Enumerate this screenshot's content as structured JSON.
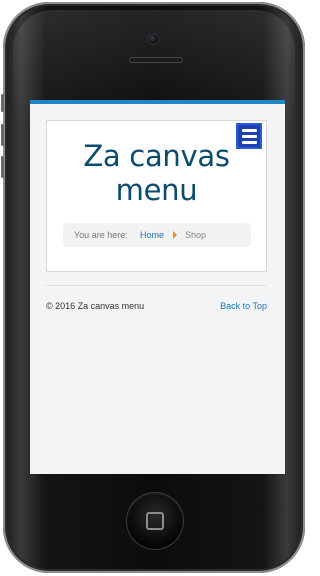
{
  "header": {
    "site_title": "Za canvas menu",
    "menu_icon": "hamburger-menu-icon"
  },
  "breadcrumb": {
    "prefix": "You are here:",
    "home_label": "Home",
    "separator_icon": "triangle-right-icon",
    "current": "Shop"
  },
  "footer": {
    "copyright": "© 2016 Za canvas menu",
    "back_to_top": "Back to Top"
  },
  "colors": {
    "accent": "#1e88c6",
    "menu_button": "#1e40b0",
    "title": "#0c4a6e",
    "link": "#1a73c8",
    "separator": "#f08a24"
  }
}
